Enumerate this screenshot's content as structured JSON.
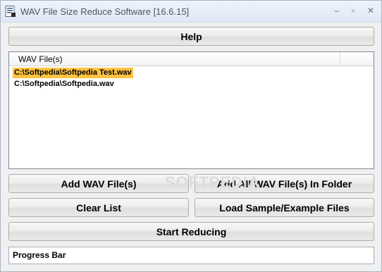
{
  "window": {
    "title": "WAV File Size Reduce Software [16.6.15]",
    "app_icon": "app-icon",
    "controls": {
      "minimize": "–",
      "maximize": "▫",
      "close": "✕"
    }
  },
  "buttons": {
    "help": "Help",
    "add_files": "Add WAV File(s)",
    "add_folder": "Add All WAV File(s) In Folder",
    "clear_list": "Clear List",
    "load_samples": "Load Sample/Example Files",
    "start": "Start Reducing"
  },
  "file_list": {
    "column_header": "WAV File(s)",
    "rows": [
      {
        "path": "C:\\Softpedia\\Softpedia Test.wav",
        "selected": true
      },
      {
        "path": "C:\\Softpedia\\Softpedia.wav",
        "selected": false
      }
    ]
  },
  "progress": {
    "label": "Progress Bar"
  },
  "watermark": "SOFTPEDIA",
  "colors": {
    "selection": "#ffc341",
    "window_bg": "#f0f0f0",
    "titlebar": "#dfe8f4"
  }
}
